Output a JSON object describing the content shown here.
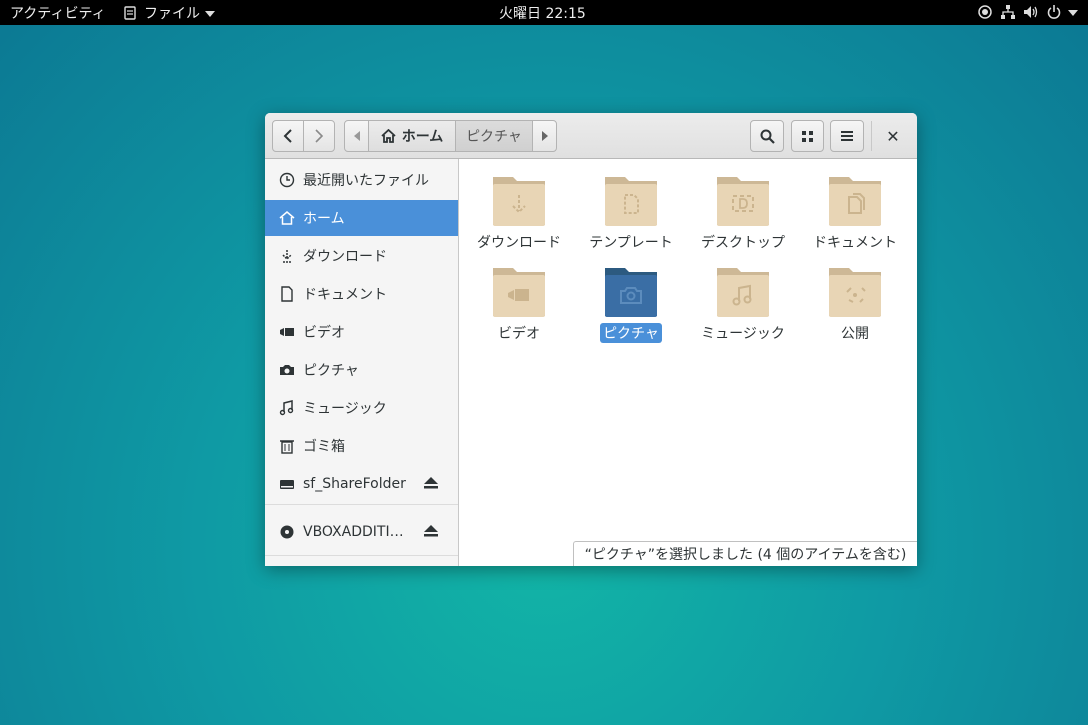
{
  "topbar": {
    "activities": "アクティビティ",
    "app_menu": "ファイル",
    "clock": "火曜日 22:15"
  },
  "headerbar": {
    "crumb_home": "ホーム",
    "crumb_current": "ピクチャ",
    "close_glyph": "✕"
  },
  "sidebar": {
    "items": [
      {
        "label": "最近開いたファイル",
        "icon": "clock-icon"
      },
      {
        "label": "ホーム",
        "icon": "home-icon",
        "active": true
      },
      {
        "label": "ダウンロード",
        "icon": "download-icon"
      },
      {
        "label": "ドキュメント",
        "icon": "document-icon"
      },
      {
        "label": "ビデオ",
        "icon": "video-icon"
      },
      {
        "label": "ピクチャ",
        "icon": "camera-icon"
      },
      {
        "label": "ミュージック",
        "icon": "music-icon"
      },
      {
        "label": "ゴミ箱",
        "icon": "trash-icon"
      },
      {
        "label": "sf_ShareFolder",
        "icon": "drive-icon"
      },
      {
        "label": "VBOXADDITI…",
        "icon": "disc-icon"
      }
    ]
  },
  "folders": [
    {
      "label": "ダウンロード",
      "icon": "download-folder-icon"
    },
    {
      "label": "テンプレート",
      "icon": "template-folder-icon"
    },
    {
      "label": "デスクトップ",
      "icon": "desktop-folder-icon"
    },
    {
      "label": "ドキュメント",
      "icon": "documents-folder-icon"
    },
    {
      "label": "ビデオ",
      "icon": "video-folder-icon"
    },
    {
      "label": "ピクチャ",
      "icon": "pictures-folder-icon",
      "selected": true
    },
    {
      "label": "ミュージック",
      "icon": "music-folder-icon"
    },
    {
      "label": "公開",
      "icon": "public-folder-icon"
    }
  ],
  "statusbar": {
    "text": "“ピクチャ”を選択しました (4 個のアイテムを含む)"
  },
  "colors": {
    "accent": "#4a90d9",
    "folder": "#e8d5b5",
    "folder_selected": "#3a6ea5"
  }
}
